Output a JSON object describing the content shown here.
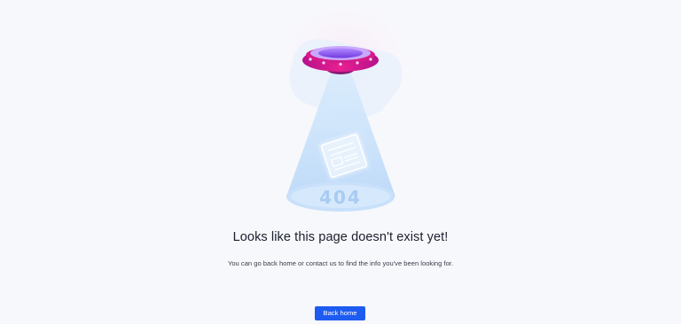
{
  "illustration": {
    "graphic": "ufo-beam-404",
    "label": "404"
  },
  "message": {
    "headline": "Looks like this page doesn't exist yet!",
    "body": "You can go back home or contact us to find the info you've been looking for."
  },
  "actions": {
    "back_home_label": "Back home"
  },
  "colors": {
    "background": "#f7f8fc",
    "primary_button": "#1e5bf0",
    "ufo_pink": "#e0168f",
    "ufo_purple": "#7a3ff0",
    "beam_blue": "#cfe4fb"
  }
}
